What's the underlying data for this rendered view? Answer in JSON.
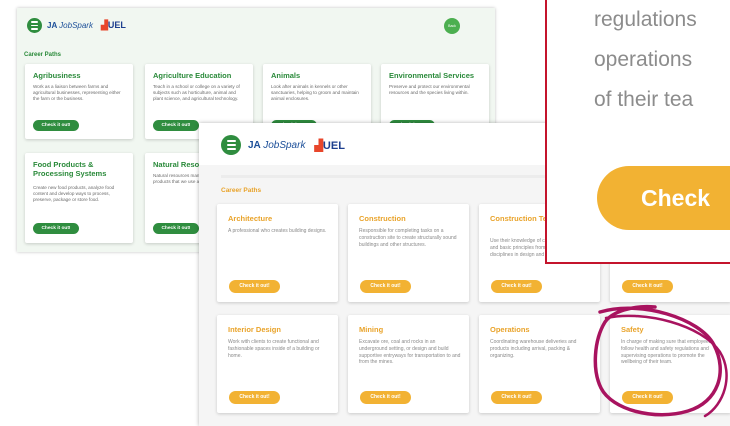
{
  "back_page": {
    "brand": {
      "prefix": "JA",
      "name": "JobSpark",
      "uel": "UEL"
    },
    "header_button": "Back",
    "section_title": "Career Paths",
    "cards": [
      {
        "title": "Agribusiness",
        "desc": "Work as a liaison between farms and agricultural businesses, representing either the farm or the business.",
        "button": "Check it out!"
      },
      {
        "title": "Agriculture Education",
        "desc": "Teach in a school or college on a variety of subjects such as horticulture, animal and plant science, and agricultural technology.",
        "button": "Check it out!"
      },
      {
        "title": "Animals",
        "desc": "Look after animals in kennels or other sanctuaries, helping to groom and maintain animal enclosures.",
        "button": "Check it out!"
      },
      {
        "title": "Environmental Services",
        "desc": "Preserve and protect our environmental resources and the species living within.",
        "button": "Check it out!"
      },
      {
        "title": "Food Products & Processing Systems",
        "desc": "Create new food products, analyze food content and develop ways to process, preserve, package or store food.",
        "button": "Check it out!"
      },
      {
        "title": "Natural Resources",
        "desc": "Natural resources managers are in charge of products that we use and environment.",
        "button": "Check it out!"
      }
    ]
  },
  "front_page": {
    "brand": {
      "prefix": "JA",
      "name": "JobSpark",
      "uel": "UEL"
    },
    "section_title": "Career Paths",
    "cards": [
      {
        "title": "Architecture",
        "desc": "A professional who creates building designs.",
        "button": "Check it out!"
      },
      {
        "title": "Construction",
        "desc": "Responsible for completing tasks on a construction site to create structurally sound buildings and other structures.",
        "button": "Check it out!"
      },
      {
        "title": "Construction Technology",
        "desc": "Use their knowledge of construction, building, and basic principles from various engineering disciplines in design and construction projects.",
        "button": "Check it out!"
      },
      {
        "title": "",
        "desc": "",
        "button": "Check it out!"
      },
      {
        "title": "Interior Design",
        "desc": "Work with clients to create functional and fashionable spaces inside of a building or home.",
        "button": "Check it out!"
      },
      {
        "title": "Mining",
        "desc": "Excavate ore, coal and rocks in an underground setting, or design and build supportive entryways for transportation to and from the mines.",
        "button": "Check it out!"
      },
      {
        "title": "Operations",
        "desc": "Coordinating warehouse deliveries and products including arrival, packing & organizing.",
        "button": "Check it out!"
      },
      {
        "title": "Safety",
        "desc": "In charge of making sure that employees follow health and safety regulations and supervising operations to promote the wellbeing of their team.",
        "button": "Check it out!"
      }
    ]
  },
  "zoom": {
    "lines": [
      "regulations",
      "operations",
      "of their tea"
    ],
    "button": "Check"
  },
  "colors": {
    "back_accent": "#2f8d3f",
    "front_accent": "#f2b233",
    "zoom_border": "#c4142c",
    "annotation": "#a8135f"
  }
}
